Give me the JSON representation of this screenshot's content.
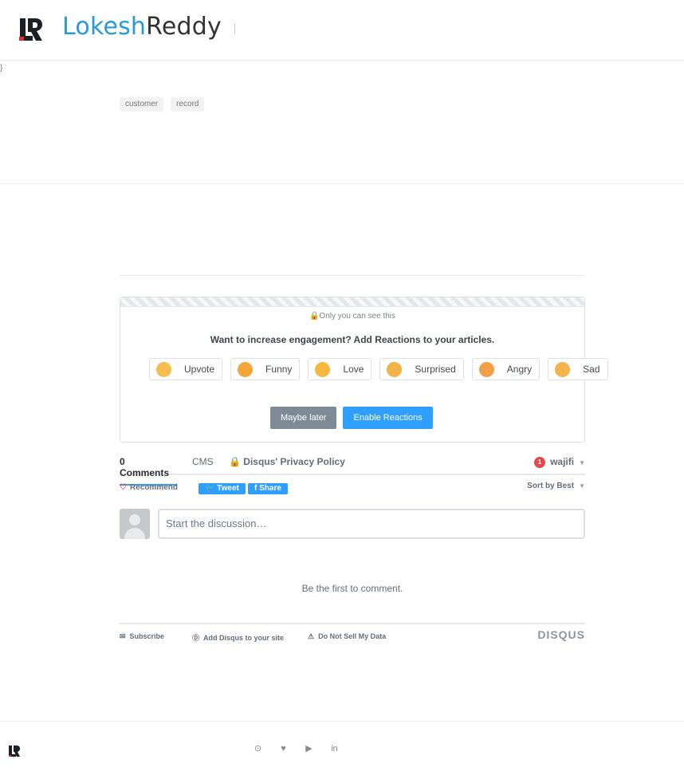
{
  "header": {
    "brand_first": "Lokesh",
    "brand_second": "Reddy"
  },
  "stray_mark": "}",
  "tags": [
    "customer",
    "record"
  ],
  "reactions": {
    "private_notice": "Only you can see this",
    "question": "Want to increase engagement? Add Reactions to your articles.",
    "items": [
      {
        "label": "Upvote",
        "icon": "thumbs-up-icon",
        "color": "#f3be4f"
      },
      {
        "label": "Funny",
        "icon": "funny-face-icon",
        "color": "#f3a73b"
      },
      {
        "label": "Love",
        "icon": "heart-eyes-icon",
        "color": "#f5b93f"
      },
      {
        "label": "Surprised",
        "icon": "surprised-face-icon",
        "color": "#f3b247"
      },
      {
        "label": "Angry",
        "icon": "angry-face-icon",
        "color": "#f29f48"
      },
      {
        "label": "Sad",
        "icon": "sad-face-icon",
        "color": "#f4b44c"
      }
    ],
    "maybe_later": "Maybe later",
    "enable": "Enable Reactions"
  },
  "disqus": {
    "comments_count": "0 Comments",
    "site": "CMS",
    "privacy": "Disqus' Privacy Policy",
    "notification_count": "1",
    "user": "wajifi",
    "recommend": "Recommend",
    "tweet": "Tweet",
    "share": "Share",
    "sort": "Sort by Best",
    "input_placeholder": "Start the discussion…",
    "empty": "Be the first to comment.",
    "subscribe": "Subscribe",
    "add_disqus": "Add Disqus to your site",
    "do_not_sell": "Do Not Sell My Data",
    "logo": "DISQUS"
  },
  "footer": {
    "socials": [
      {
        "icon": "github-icon",
        "glyph": "⊙"
      },
      {
        "icon": "twitter-icon",
        "glyph": "♥"
      },
      {
        "icon": "youtube-icon",
        "glyph": "▶"
      },
      {
        "icon": "linkedin-icon",
        "glyph": "in"
      }
    ]
  },
  "colors": {
    "brand_blue": "#2a9ad6",
    "disqus_blue": "#2e9fff",
    "logo_red": "#d8322f"
  }
}
